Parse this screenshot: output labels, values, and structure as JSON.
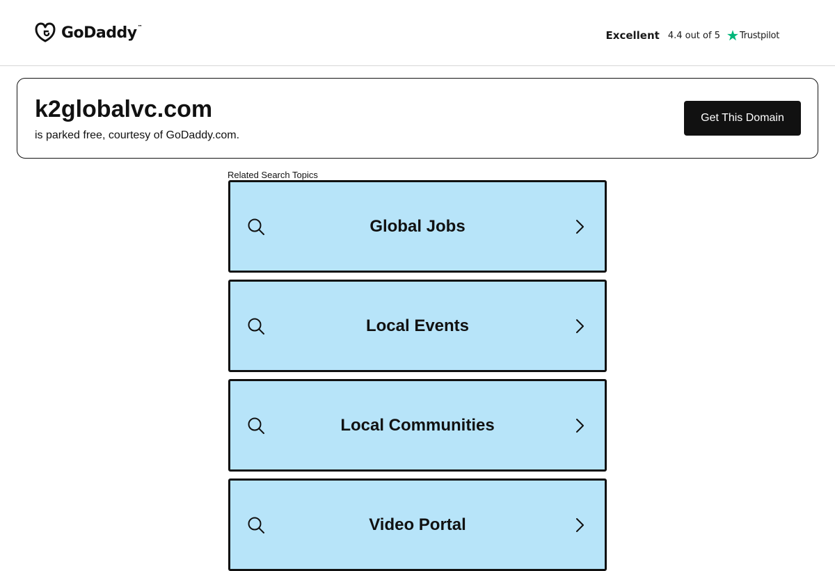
{
  "header": {
    "logo": {
      "text": "GoDaddy",
      "trademark": "™",
      "icon": "godaddy-logo-icon"
    },
    "rating": {
      "label": "Excellent",
      "score": "4.4 out of 5",
      "provider": "Trustpilot",
      "icon": "trustpilot-star-icon",
      "star_color": "#00b67a"
    }
  },
  "domain": {
    "name": "k2globalvc.com",
    "subtitle": "is parked free, courtesy of GoDaddy.com.",
    "cta_label": "Get This Domain"
  },
  "related": {
    "label": "Related Search Topics",
    "topic_bg_color": "#b7e4f9",
    "topics": [
      {
        "label": "Global Jobs",
        "icon": "search-icon",
        "arrow": "chevron-right-icon"
      },
      {
        "label": "Local Events",
        "icon": "search-icon",
        "arrow": "chevron-right-icon"
      },
      {
        "label": "Local Communities",
        "icon": "search-icon",
        "arrow": "chevron-right-icon"
      },
      {
        "label": "Video Portal",
        "icon": "search-icon",
        "arrow": "chevron-right-icon"
      }
    ]
  }
}
